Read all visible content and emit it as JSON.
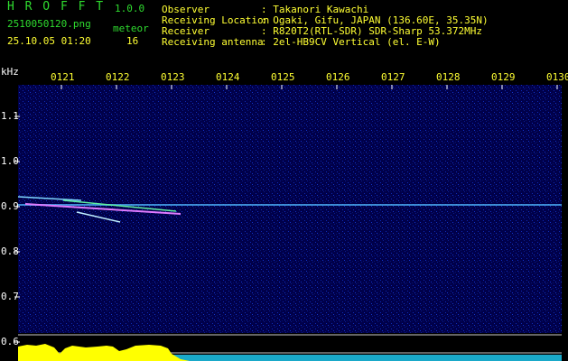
{
  "header": {
    "app_name": "H R O F F T",
    "version": "1.0.0",
    "filename": "2510050120.png",
    "datetime": "25.10.05 01:20",
    "meteor_label": "meteor",
    "meteor_count": "16",
    "info": [
      {
        "key": "Observer",
        "value": ": Takanori Kawachi"
      },
      {
        "key": "Receiving Location",
        "value": ": Ogaki, Gifu, JAPAN (136.60E, 35.35N)"
      },
      {
        "key": "Receiver",
        "value": ": R820T2(RTL-SDR) SDR-Sharp 53.372MHz"
      },
      {
        "key": "Receiving antenna",
        "value": ": 2el-HB9CV Vertical (el. E-W)"
      }
    ]
  },
  "spectrogram": {
    "unit_label": "kHz",
    "time_labels": [
      "0121",
      "0122",
      "0123",
      "0124",
      "0125",
      "0126",
      "0127",
      "0128",
      "0129",
      "0130"
    ],
    "freq_labels": [
      "1.1",
      "1.0",
      "0.9",
      "0.8",
      "0.7",
      "0.6"
    ],
    "colors": {
      "background": "#00004a",
      "signal": "#4fb7ff",
      "level": "#ffff00",
      "tick": "#ffffff"
    }
  }
}
